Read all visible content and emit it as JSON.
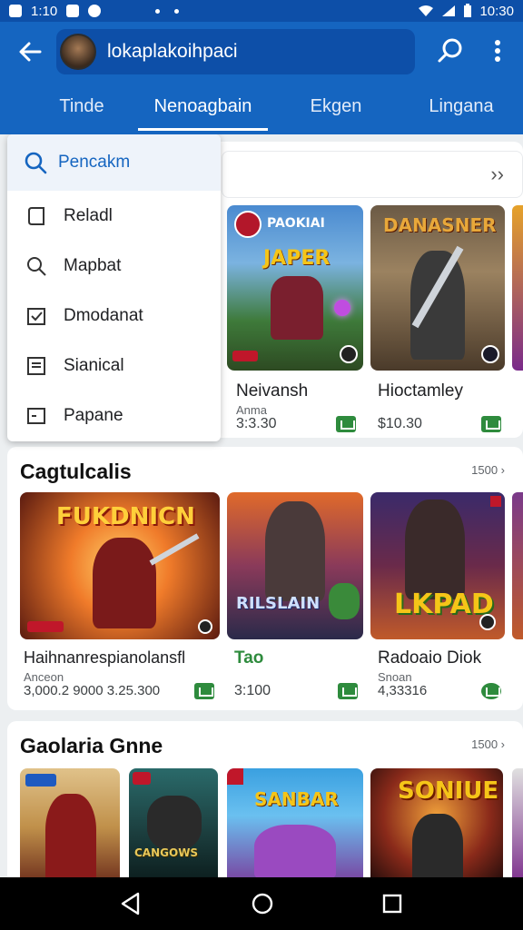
{
  "status_bar": {
    "time_left": "1:10",
    "time_right": "10:30"
  },
  "app_bar": {
    "query": "lokaplakoihpaci",
    "tabs": [
      "Tinde",
      "Nenoagbain",
      "Ekgen",
      "Lingana"
    ],
    "active_tab": 1
  },
  "menu": {
    "search_label": "Pencakm",
    "items": [
      "Reladl",
      "Mapbat",
      "Dmodanat",
      "Sianical",
      "Papane"
    ],
    "icons": [
      "tag-icon",
      "search-icon",
      "calendar-icon",
      "list-icon",
      "page-icon"
    ]
  },
  "top_row": {
    "games": [
      {
        "art_title": "PAOKIAI",
        "art_subtitle": "JAPER",
        "title": "Neivansh",
        "sub": "Anma",
        "price": "3:3.30",
        "accent": "#3b6fd6"
      },
      {
        "art_title": "DANASNER",
        "title": "Hioctamley",
        "price": "$10.30",
        "accent": "#7a5e3c"
      }
    ]
  },
  "section2": {
    "title": "Cagtulcalis",
    "more": "1500",
    "games": [
      {
        "art_title": "FUKDNICN",
        "title": "Haihnanrespianolansfl",
        "sub": "Anceon",
        "price": "3,000.2 9000 3.25.300"
      },
      {
        "art_title": "RILSLAIN",
        "title": "Tao",
        "price": "3:100"
      },
      {
        "art_title": "LKPAD",
        "title": "Radoaio Diok",
        "sub": "Snoan",
        "price": "4,33316"
      }
    ]
  },
  "section3": {
    "title": "Gaolaria Gnne",
    "more": "1500",
    "games": [
      {
        "art_title": ""
      },
      {
        "art_title": "CANGOWS"
      },
      {
        "art_title": "SANBAR"
      },
      {
        "art_title": "SONIUE"
      }
    ]
  }
}
